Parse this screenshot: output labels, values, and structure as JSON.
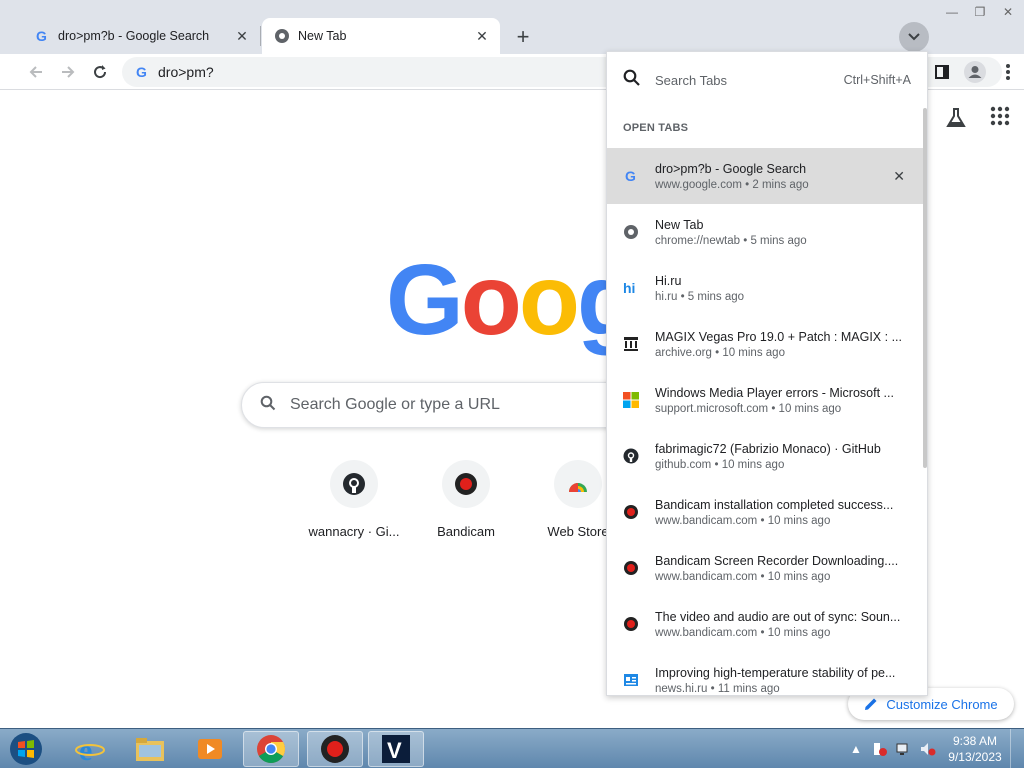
{
  "tabs": [
    {
      "title": "dro>pm?b - Google Search",
      "favicon": "google-g-icon",
      "active": false
    },
    {
      "title": "New Tab",
      "favicon": "chrome-icon",
      "active": true
    }
  ],
  "toolbar": {
    "url": "dro>pm?"
  },
  "ntp": {
    "logo_letters": [
      "G",
      "o",
      "o",
      "g"
    ],
    "logo_colors": [
      "#4285f4",
      "#ea4335",
      "#fbbc05",
      "#4285f4"
    ],
    "search_placeholder": "Search Google or type a URL",
    "shortcuts": [
      {
        "label": "wannacry · Gi...",
        "icon": "github-icon"
      },
      {
        "label": "Bandicam",
        "icon": "bandicam-icon"
      },
      {
        "label": "Web Store",
        "icon": "web-store-icon"
      }
    ],
    "customize_label": "Customize Chrome"
  },
  "tab_search": {
    "placeholder": "Search Tabs",
    "shortcut": "Ctrl+Shift+A",
    "section": "OPEN TABS",
    "items": [
      {
        "title": "dro>pm?b - Google Search",
        "url": "www.google.com",
        "time": "2 mins ago",
        "icon": "google-g-icon"
      },
      {
        "title": "New Tab",
        "url": "chrome://newtab",
        "time": "5 mins ago",
        "icon": "chrome-icon"
      },
      {
        "title": "Hi.ru",
        "url": "hi.ru",
        "time": "5 mins ago",
        "icon": "hi-ru-icon"
      },
      {
        "title": "MAGIX Vegas Pro 19.0 + Patch : MAGIX : ...",
        "url": "archive.org",
        "time": "10 mins ago",
        "icon": "archive-icon"
      },
      {
        "title": "Windows Media Player errors - Microsoft ...",
        "url": "support.microsoft.com",
        "time": "10 mins ago",
        "icon": "microsoft-icon"
      },
      {
        "title": "fabrimagic72 (Fabrizio Monaco) · GitHub",
        "url": "github.com",
        "time": "10 mins ago",
        "icon": "github-icon"
      },
      {
        "title": "Bandicam installation completed success...",
        "url": "www.bandicam.com",
        "time": "10 mins ago",
        "icon": "bandicam-icon"
      },
      {
        "title": "Bandicam Screen Recorder Downloading....",
        "url": "www.bandicam.com",
        "time": "10 mins ago",
        "icon": "bandicam-icon"
      },
      {
        "title": "The video and audio are out of sync: Soun...",
        "url": "www.bandicam.com",
        "time": "10 mins ago",
        "icon": "bandicam-icon"
      },
      {
        "title": "Improving high-temperature stability of pe...",
        "url": "news.hi.ru",
        "time": "11 mins ago",
        "icon": "news-icon"
      }
    ]
  },
  "taskbar": {
    "time": "9:38 AM",
    "date": "9/13/2023"
  }
}
